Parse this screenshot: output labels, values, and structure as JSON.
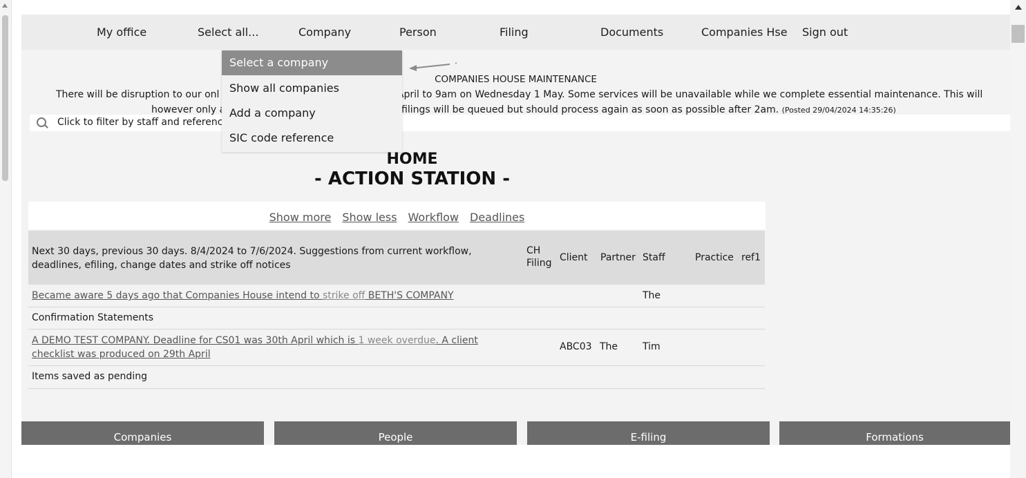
{
  "nav": {
    "items": [
      {
        "label": "My office"
      },
      {
        "label": "Select all..."
      },
      {
        "label": "Company"
      },
      {
        "label": "Person"
      },
      {
        "label": "Filing"
      },
      {
        "label": "Documents"
      },
      {
        "label": "Companies Hse"
      },
      {
        "label": "Sign out"
      }
    ]
  },
  "dropdown": {
    "items": [
      {
        "label": "Select a company",
        "selected": true
      },
      {
        "label": "Show all companies"
      },
      {
        "label": "Add a company"
      },
      {
        "label": "SIC code reference"
      }
    ]
  },
  "notice": {
    "heading": "COMPANIES HOUSE MAINTENANCE",
    "line1_left": "There will be disruption to our onl",
    "line1_right": ") April to 9am on Wednesday 1 May. Some services will be unavailable while we complete essential maintenance. This will",
    "line2_left": "however only a",
    "line2_right": "filings will be queued but should process again as soon as possible after 2am.",
    "posted": "(Posted 29/04/2024 14:35:26)"
  },
  "filter": {
    "label": "Click to filter by staff and referenc",
    "icon": "search-icon"
  },
  "home": {
    "title": "HOME",
    "subtitle": "- ACTION STATION -"
  },
  "panel": {
    "links": [
      "Show more",
      "Show less",
      "Workflow",
      "Deadlines"
    ],
    "header": {
      "description": "Next 30 days, previous 30 days. 8/4/2024 to 7/6/2024. Suggestions from current workflow, deadlines, efiling, change dates and strike off notices",
      "ch_filing_1": "CH",
      "ch_filing_2": "Filing",
      "client": "Client",
      "partner": "Partner",
      "staff": "Staff",
      "practice": "Practice",
      "ref1": "ref1"
    },
    "rows": {
      "strike_off": {
        "text_a": "Became aware 5 days ago that Companies House intend to ",
        "text_b": "strike off",
        "text_c": " BETH'S COMPANY",
        "staff": "The"
      },
      "section1": "Confirmation Statements",
      "demo": {
        "text_a": "A DEMO TEST COMPANY.",
        "text_b": " Deadline for CS01 was 30th April which is ",
        "text_c": "1 week overdue",
        "text_d": ". A client",
        "text_e": "checklist was produced on 29th April",
        "client": "ABC03",
        "partner": "The",
        "staff": "Tim"
      },
      "section2": "Items saved as pending"
    }
  },
  "tiles": [
    {
      "label": "Companies"
    },
    {
      "label": "People"
    },
    {
      "label": "E-filing"
    },
    {
      "label": "Formations"
    }
  ],
  "colors": {
    "nav_bg": "#ececec",
    "dropdown_selected": "#8c8c8c",
    "tile_bg": "#6c6c6c",
    "table_head_bg": "#dcdcdc"
  }
}
